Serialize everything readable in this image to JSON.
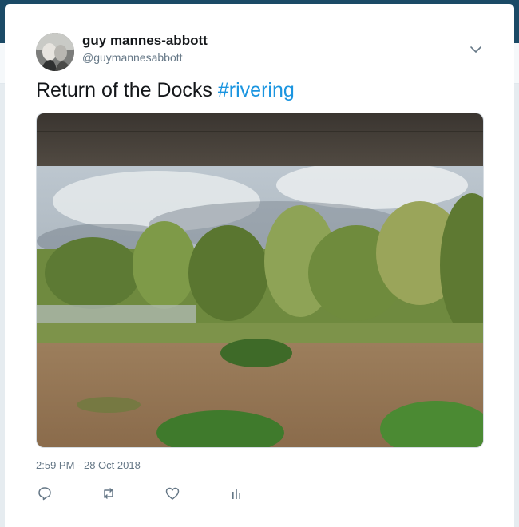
{
  "tweet": {
    "author_name": "guy mannes-abbott",
    "author_handle": "@guymannesabbott",
    "text": "Return of the Docks ",
    "hashtag": "#rivering",
    "timestamp": "2:59 PM - 28 Oct 2018"
  },
  "icons": {
    "menu": "chevron-down-icon",
    "reply": "reply-icon",
    "retweet": "retweet-icon",
    "like": "heart-icon",
    "analytics": "analytics-icon"
  },
  "colors": {
    "hashtag": "#1b95e0",
    "secondary_text": "#657786",
    "top_bar": "#1b4a66"
  }
}
